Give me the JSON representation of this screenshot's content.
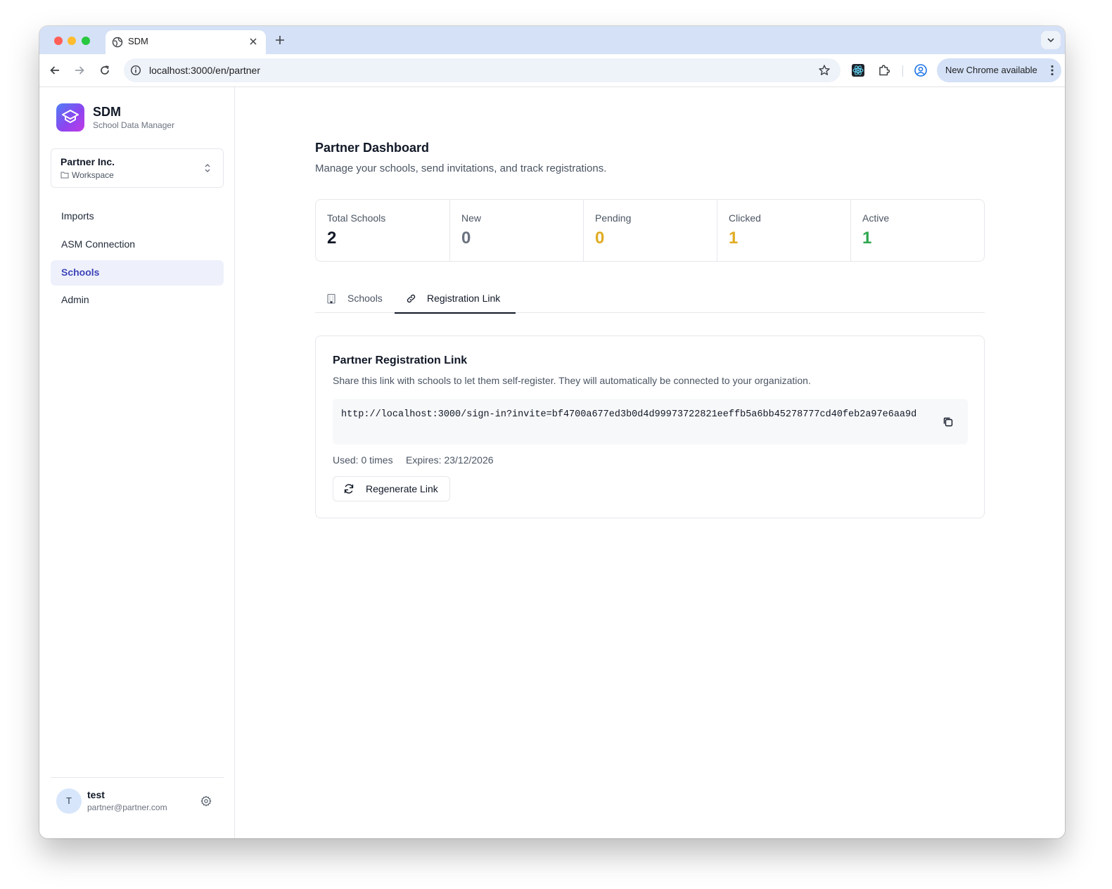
{
  "browser": {
    "tab_title": "SDM",
    "url": "localhost:3000/en/partner",
    "update_label": "New Chrome available"
  },
  "sidebar": {
    "app_name": "SDM",
    "app_subtitle": "School Data Manager",
    "workspace": {
      "name": "Partner Inc.",
      "subtitle": "Workspace"
    },
    "nav": [
      {
        "label": "Imports",
        "active": false
      },
      {
        "label": "ASM Connection",
        "active": false
      },
      {
        "label": "Schools",
        "active": true
      },
      {
        "label": "Admin",
        "active": false
      }
    ],
    "user": {
      "initial": "T",
      "name": "test",
      "email": "partner@partner.com"
    }
  },
  "main": {
    "title": "Partner Dashboard",
    "description": "Manage your schools, send invitations, and track registrations.",
    "stats": [
      {
        "label": "Total Schools",
        "value": "2",
        "color": "#111827"
      },
      {
        "label": "New",
        "value": "0",
        "color": "#6b7280"
      },
      {
        "label": "Pending",
        "value": "0",
        "color": "#e0ac24"
      },
      {
        "label": "Clicked",
        "value": "1",
        "color": "#e0ac24"
      },
      {
        "label": "Active",
        "value": "1",
        "color": "#2fa84f"
      }
    ],
    "tabs": [
      {
        "label": "Schools",
        "icon": "building-icon",
        "active": false
      },
      {
        "label": "Registration Link",
        "icon": "link-icon",
        "active": true
      }
    ],
    "registration": {
      "title": "Partner Registration Link",
      "description": "Share this link with schools to let them self-register. They will automatically be connected to your organization.",
      "link": "http://localhost:3000/sign-in?invite=bf4700a677ed3b0d4d99973722821eeffb5a6bb45278777cd40feb2a97e6aa9d",
      "used": "Used: 0 times",
      "expires": "Expires: 23/12/2026",
      "regenerate_label": "Regenerate Link"
    }
  },
  "colors": {
    "accent": "#3e44b8",
    "nav_active_bg": "#eef1fb",
    "pending": "#e0ac24",
    "active": "#2fa84f",
    "browser_chrome": "#d4e1f7"
  }
}
